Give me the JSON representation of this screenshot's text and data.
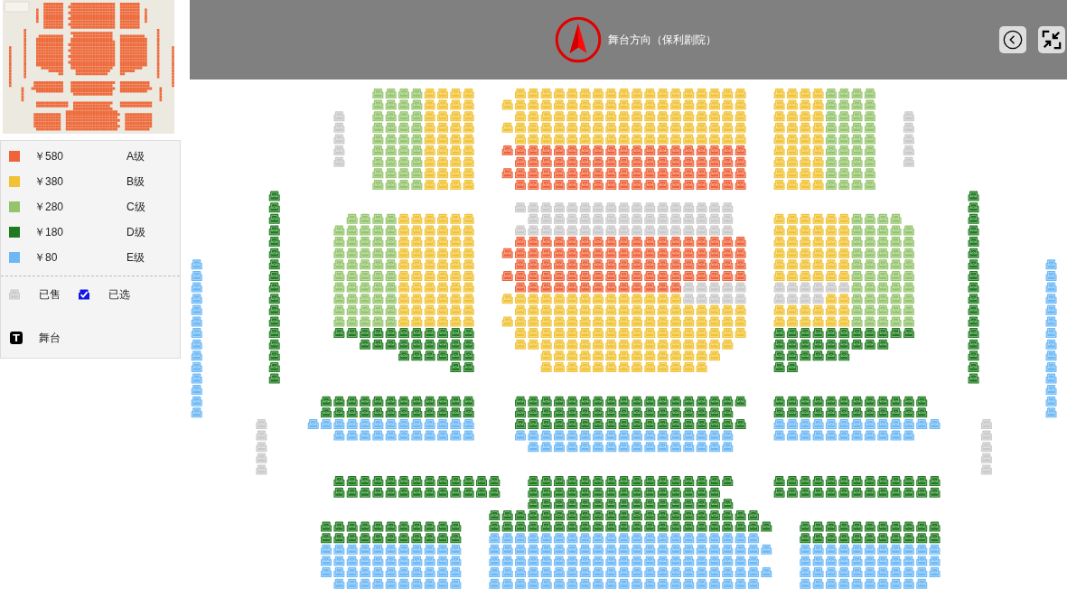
{
  "header": {
    "title": "舞台方向（保利剧院）"
  },
  "legend": {
    "tiers": [
      {
        "price": "￥580",
        "grade": "A级",
        "color": "#ee633a"
      },
      {
        "price": "￥380",
        "grade": "B级",
        "color": "#f1c234"
      },
      {
        "price": "￥280",
        "grade": "C级",
        "color": "#94c46c"
      },
      {
        "price": "￥180",
        "grade": "D级",
        "color": "#1f7a1f"
      },
      {
        "price": "￥80",
        "grade": "E级",
        "color": "#6cb8f6"
      }
    ],
    "statuses": [
      {
        "kind": "sold",
        "label": "已售"
      },
      {
        "kind": "selected",
        "label": "已选"
      },
      {
        "kind": "stage",
        "label": "舞台",
        "symbol": "T"
      }
    ]
  }
}
